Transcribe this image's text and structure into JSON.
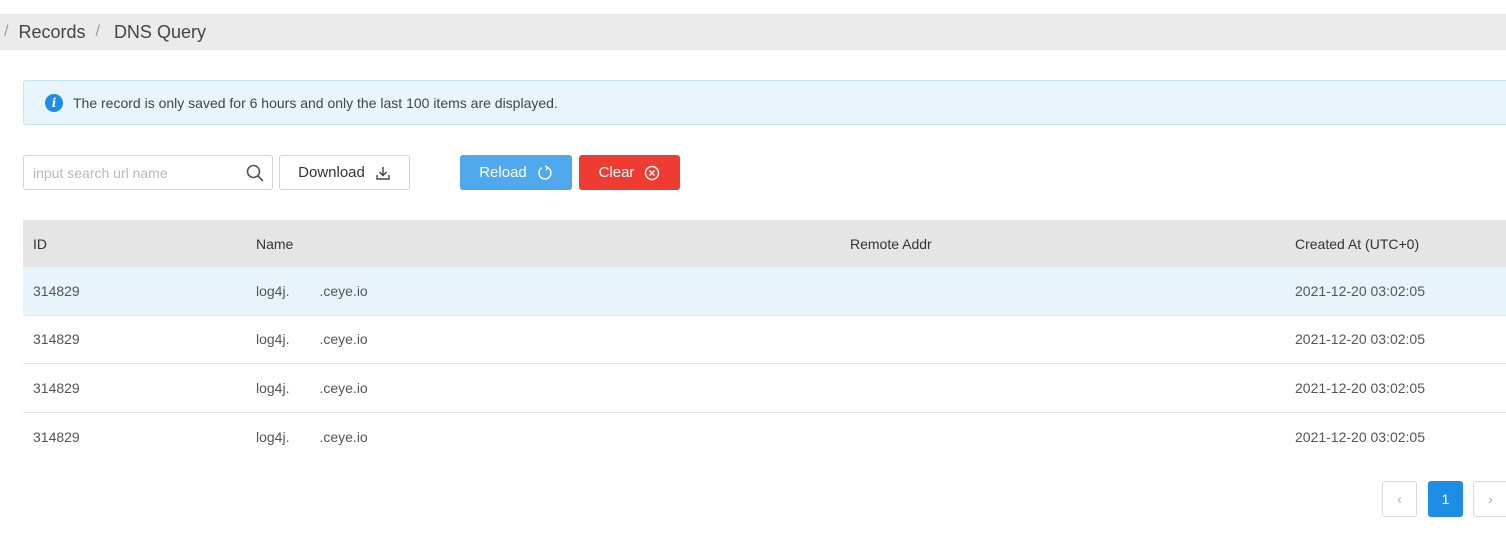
{
  "breadcrumb": {
    "sep": "/",
    "records": "Records",
    "dns_query": "DNS Query"
  },
  "alert": {
    "text": "The record is only saved for 6 hours and only the last 100 items are displayed."
  },
  "toolbar": {
    "search_placeholder": "input search url name",
    "search_value": "",
    "download_label": "Download",
    "reload_label": "Reload",
    "clear_label": "Clear"
  },
  "table": {
    "headers": [
      "ID",
      "Name",
      "Remote Addr",
      "Created At (UTC+0)"
    ],
    "rows": [
      {
        "id": "314829",
        "name": "log4j.",
        "name_suffix": ".ceye.io",
        "remote": "",
        "created": "2021-12-20 03:02:05"
      },
      {
        "id": "314829",
        "name": "log4j.",
        "name_suffix": ".ceye.io",
        "remote": "",
        "created": "2021-12-20 03:02:05"
      },
      {
        "id": "314829",
        "name": "log4j.",
        "name_suffix": ".ceye.io",
        "remote": "",
        "created": "2021-12-20 03:02:05"
      },
      {
        "id": "314829",
        "name": "log4j.",
        "name_suffix": ".ceye.io",
        "remote": "",
        "created": "2021-12-20 03:02:05"
      }
    ]
  },
  "pagination": {
    "prev": "‹",
    "current_page": "1",
    "next": "›"
  },
  "colors": {
    "primary": "#1e8ee4",
    "reload": "#4fa9ec",
    "danger": "#ef3c33",
    "alert_bg": "#e9f5fc",
    "header_bg": "#e5e5e5",
    "highlight_row": "#e8f4fb"
  },
  "icons": {
    "info": "info-icon",
    "search": "search-icon",
    "download": "download-icon",
    "reload": "reload-icon",
    "clear": "clear-circle-icon"
  }
}
